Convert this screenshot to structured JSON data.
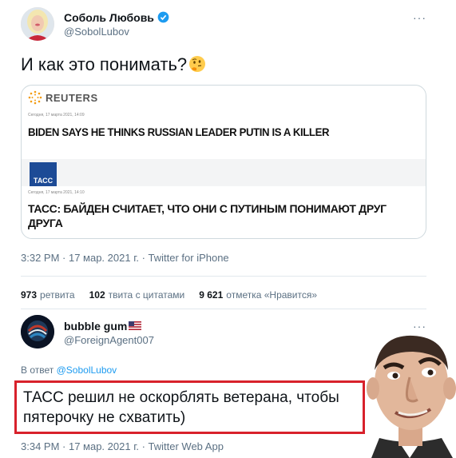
{
  "tweet": {
    "author_name": "Соболь Любовь",
    "author_handle": "@SobolLubov",
    "text": "И как это понимать?",
    "more_label": "···",
    "meta": "3:32 PM · 17 мар. 2021 г. · Twitter for iPhone",
    "card": {
      "source_1": "REUTERS",
      "date_1": "Сегодня, 17 марта 2021, 14:09",
      "headline_1": "BIDEN SAYS HE THINKS RUSSIAN LEADER PUTIN IS A KILLER",
      "source_2": "ТАСС",
      "date_2": "Сегодня, 17 марта 2021, 14:10",
      "headline_2": "ТАСС: БАЙДЕН СЧИТАЕТ, ЧТО ОНИ С ПУТИНЫМ ПОНИМАЮТ ДРУГ ДРУГА"
    },
    "stats": [
      {
        "count": "973",
        "label": "ретвита"
      },
      {
        "count": "102",
        "label": "твита с цитатами"
      },
      {
        "count": "9 621",
        "label": "отметка «Нравится»"
      }
    ]
  },
  "reply": {
    "author_name": "bubble gum",
    "author_handle": "@ForeignAgent007",
    "more_label": "···",
    "reply_prefix": "В ответ",
    "reply_target": "@SobolLubov",
    "text": "ТАСС решил не оскорблять ветерана, чтобы пятерочку не схватить)",
    "meta": "3:34 PM · 17 мар. 2021 г. · Twitter Web App"
  },
  "colors": {
    "accent": "#1d9bf0",
    "highlight_border": "#d8212b",
    "verified": "#1d9bf0"
  },
  "icons": [
    "verified-badge-icon",
    "thinking-face-emoji",
    "us-flag-emoji",
    "more-icon",
    "reuters-logo-icon",
    "tass-logo-icon"
  ]
}
